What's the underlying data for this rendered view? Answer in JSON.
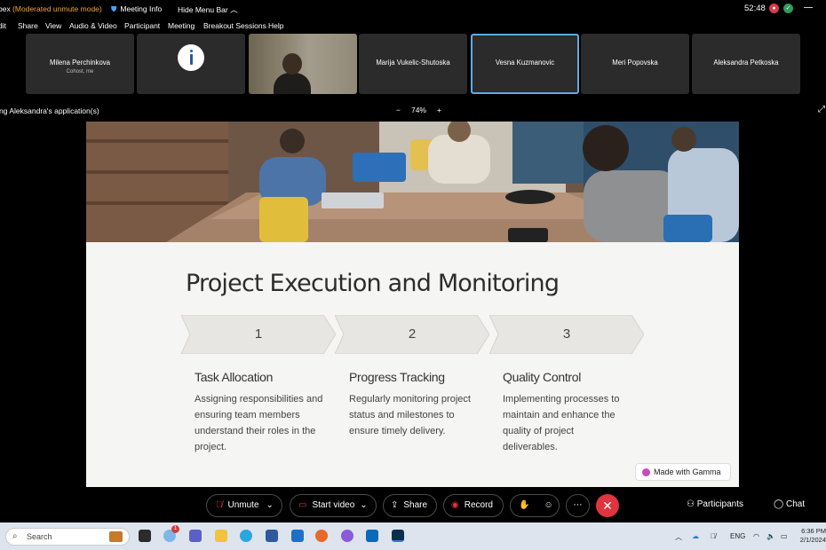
{
  "titlebar": {
    "app_name": "bex",
    "mode": "(Moderated unmute mode)",
    "meeting_info": "Meeting Info",
    "hide_menu": "Hide Menu Bar",
    "timer": "52:48"
  },
  "menu": [
    "dit",
    "Share",
    "View",
    "Audio & Video",
    "Participant",
    "Meeting",
    "Breakout Sessions",
    "Help"
  ],
  "participants": [
    {
      "name": "Milena Perchinkova",
      "sub": "Cohost, me"
    },
    {
      "name": "",
      "sub": ""
    },
    {
      "name": "",
      "sub": ""
    },
    {
      "name": "Marija Vukelic-Shutoska",
      "sub": ""
    },
    {
      "name": "Vesna Kuzmanovic",
      "sub": ""
    },
    {
      "name": "Meri Popovska",
      "sub": ""
    },
    {
      "name": "Aleksandra Petkoska",
      "sub": ""
    }
  ],
  "share": {
    "label": "ng Aleksandra's application(s)",
    "zoom_minus": "−",
    "zoom": "74%",
    "zoom_plus": "+"
  },
  "slide": {
    "title": "Project Execution and Monitoring",
    "steps": [
      {
        "num": "1",
        "title": "Task Allocation",
        "desc": "Assigning responsibilities and ensuring team members understand their roles in the project."
      },
      {
        "num": "2",
        "title": "Progress Tracking",
        "desc": "Regularly monitoring project status and milestones to ensure timely delivery."
      },
      {
        "num": "3",
        "title": "Quality Control",
        "desc": "Implementing processes to maintain and enhance the quality of project deliverables."
      }
    ],
    "badge": "Made with Gamma"
  },
  "controls": {
    "unmute": "Unmute",
    "start_video": "Start video",
    "share": "Share",
    "record": "Record",
    "participants": "Participants",
    "chat": "Chat"
  },
  "taskbar": {
    "search_placeholder": "Search",
    "lang": "ENG",
    "time": "6:36 PM",
    "date": "2/1/2024",
    "notif_count": "1"
  },
  "colors": {
    "accent_blue": "#62a8e6",
    "record_red": "#d83b4a",
    "hangup_red": "#e0343f",
    "mode_orange": "#f0a33b"
  },
  "icons": [
    "shield-icon",
    "mic-muted-icon",
    "video-off-icon",
    "share-icon",
    "record-icon",
    "raise-hand-icon",
    "reactions-icon",
    "more-icon",
    "hangup-icon",
    "participants-icon",
    "chat-icon",
    "search-icon"
  ]
}
